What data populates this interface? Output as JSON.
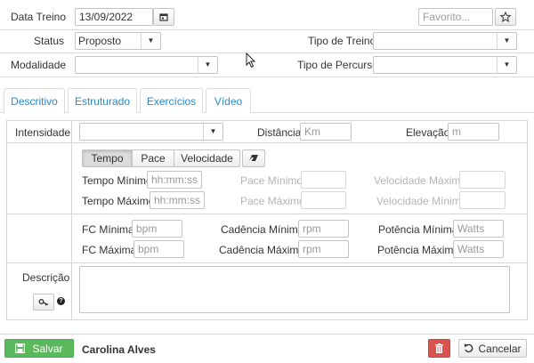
{
  "form": {
    "data_treino_label": "Data Treino",
    "data_treino_value": "13/09/2022",
    "favorito_placeholder": "Favorito...",
    "status_label": "Status",
    "status_value": "Proposto",
    "tipo_treino_label": "Tipo de Treino",
    "tipo_treino_value": "",
    "modalidade_label": "Modalidade",
    "modalidade_value": "",
    "tipo_percurso_label": "Tipo de Percurso",
    "tipo_percurso_value": ""
  },
  "tabs": [
    {
      "label": "Descritivo",
      "active": true
    },
    {
      "label": "Estruturado",
      "active": false
    },
    {
      "label": "Exercícios",
      "active": false
    },
    {
      "label": "Vídeo",
      "active": false
    }
  ],
  "descritivo": {
    "intensidade_label": "Intensidade",
    "intensidade_value": "",
    "distancia_label": "Distância",
    "distancia_placeholder": "Km",
    "elevacao_label": "Elevação",
    "elevacao_placeholder": "m",
    "mode_buttons": [
      "Tempo",
      "Pace",
      "Velocidade"
    ],
    "mode_selected": "Tempo",
    "tempo_minimo_label": "Tempo Mínimo",
    "tempo_minimo_placeholder": "hh:mm:ss",
    "tempo_maximo_label": "Tempo Máximo",
    "tempo_maximo_placeholder": "hh:mm:ss",
    "pace_minimo_label": "Pace Mínimo",
    "pace_maximo_label": "Pace Máximo",
    "velocidade_maxima_label": "Velocidade Máxima",
    "velocidade_minima_label": "Velocidade Mínima",
    "fc_minima_label": "FC Mínima",
    "fc_maxima_label": "FC Máxima",
    "bpm_placeholder": "bpm",
    "cadencia_minima_label": "Cadência Mínima",
    "cadencia_maxima_label": "Cadência Máxima",
    "rpm_placeholder": "rpm",
    "potencia_minima_label": "Potência Mínima",
    "potencia_maxima_label": "Potência Máxima",
    "watts_placeholder": "Watts",
    "descricao_label": "Descrição",
    "descricao_value": "",
    "help_glyph": "?"
  },
  "footer": {
    "save_label": "Salvar",
    "athlete_name": "Carolina Alves",
    "cancel_label": "Cancelar"
  },
  "colors": {
    "tab_link": "#2a8bc8",
    "save_green": "#5cb85c",
    "delete_red": "#d9534f"
  },
  "icons": [
    "calendar-icon",
    "star-icon",
    "chevron-down-icon",
    "eraser-icon",
    "key-icon",
    "question-icon",
    "floppy-icon",
    "trash-icon",
    "undo-icon",
    "cursor-icon"
  ]
}
